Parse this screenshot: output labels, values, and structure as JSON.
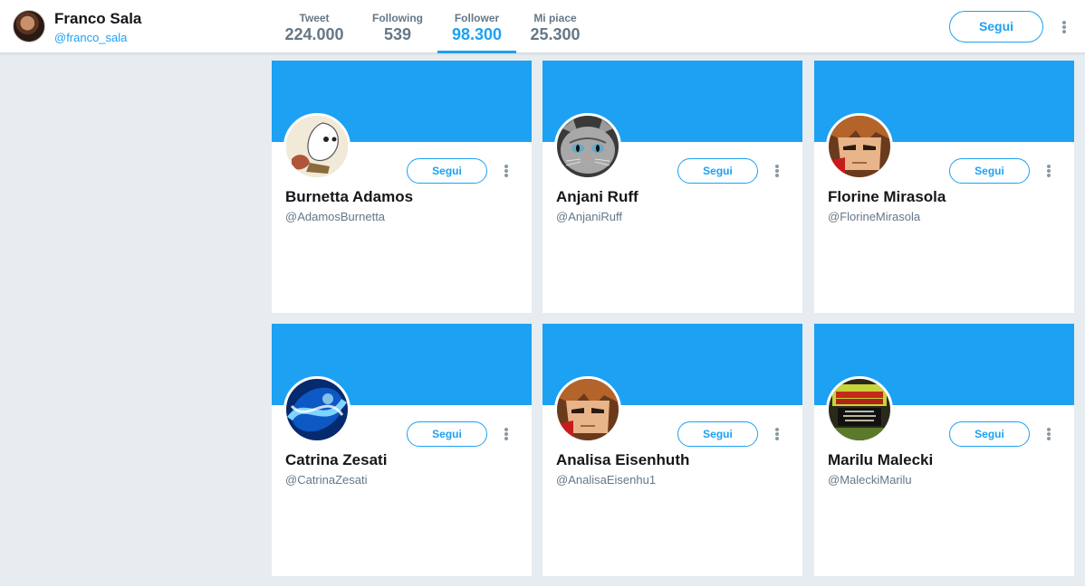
{
  "profile": {
    "name": "Franco Sala",
    "handle": "@franco_sala"
  },
  "stats": [
    {
      "label": "Tweet",
      "value": "224.000"
    },
    {
      "label": "Following",
      "value": "539"
    },
    {
      "label": "Follower",
      "value": "98.300",
      "active": true
    },
    {
      "label": "Mi piace",
      "value": "25.300"
    }
  ],
  "header": {
    "follow_label": "Segui"
  },
  "colors": {
    "accent": "#1da1f2",
    "background": "#e6ecf0"
  },
  "followers": [
    {
      "name": "Burnetta Adamos",
      "handle": "@AdamosBurnetta",
      "follow_label": "Segui",
      "avatar": "cartoon-ghost-avatar"
    },
    {
      "name": "Anjani Ruff",
      "handle": "@AnjaniRuff",
      "follow_label": "Segui",
      "avatar": "cat-avatar"
    },
    {
      "name": "Florine Mirasola",
      "handle": "@FlorineMirasola",
      "follow_label": "Segui",
      "avatar": "anime-character-avatar"
    },
    {
      "name": "Catrina Zesati",
      "handle": "@CatrinaZesati",
      "follow_label": "Segui",
      "avatar": "blue-abstract-avatar"
    },
    {
      "name": "Analisa Eisenhuth",
      "handle": "@AnalisaEisenhu1",
      "follow_label": "Segui",
      "avatar": "anime-character-avatar"
    },
    {
      "name": "Marilu Malecki",
      "handle": "@MaleckiMarilu",
      "follow_label": "Segui",
      "avatar": "chinese-restaurant-sign-avatar"
    }
  ]
}
